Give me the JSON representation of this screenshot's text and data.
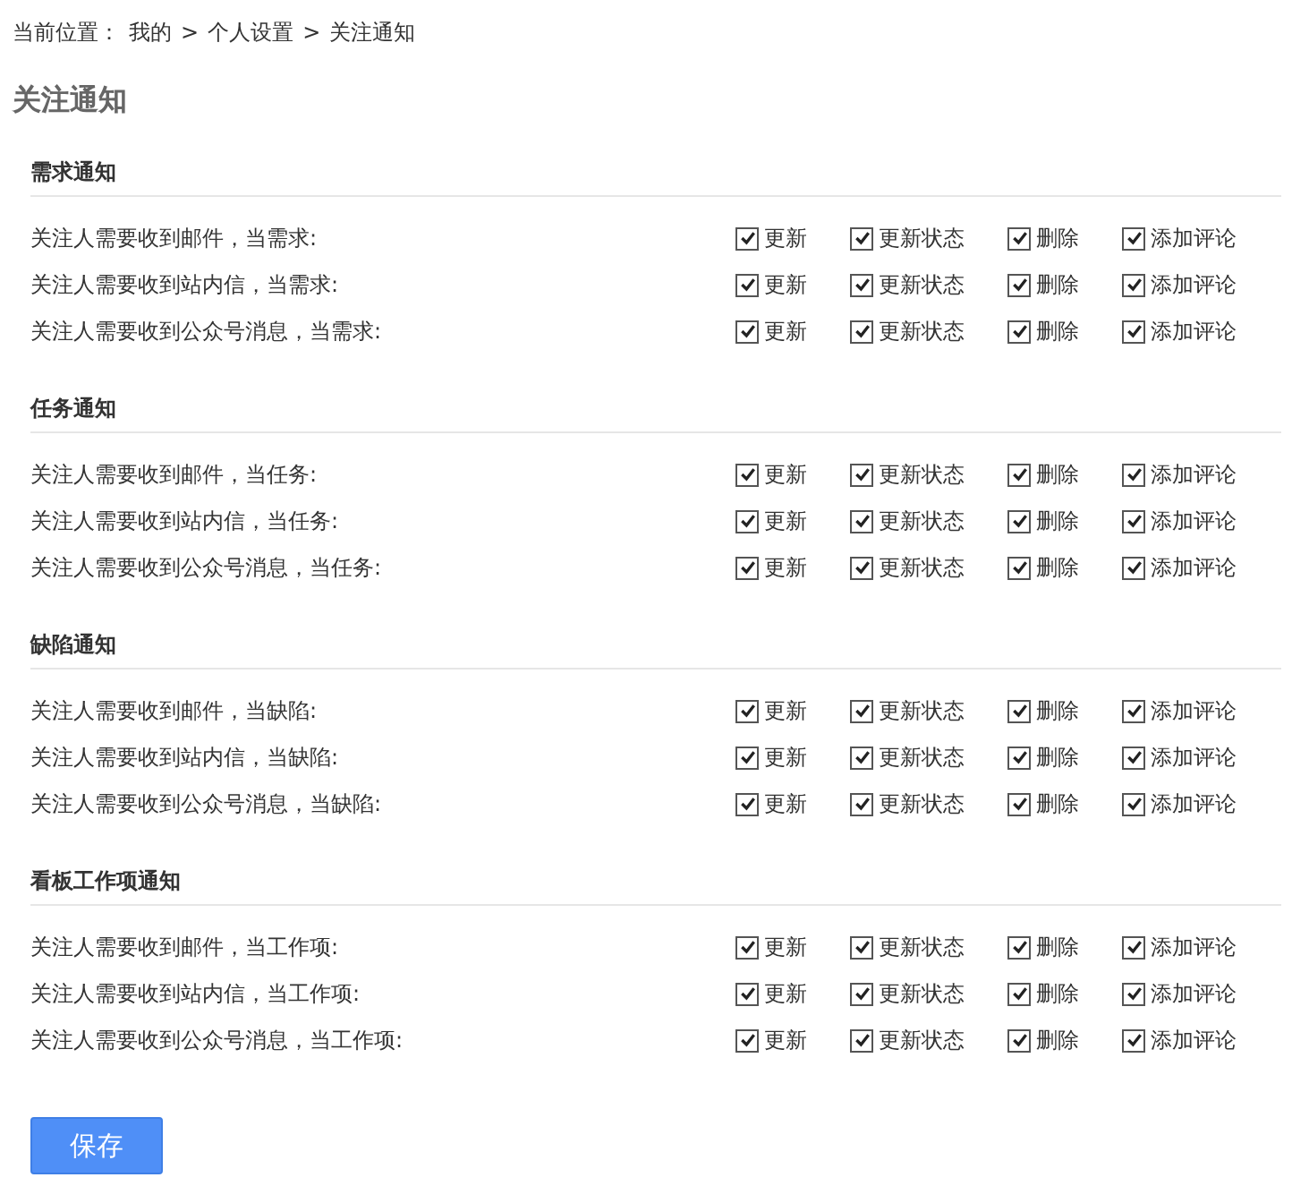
{
  "breadcrumb": {
    "label": "当前位置：",
    "separator": ">",
    "items": [
      "我的",
      "个人设置",
      "关注通知"
    ]
  },
  "title": "关注通知",
  "sections": [
    {
      "heading": "需求通知",
      "rows": [
        {
          "label": "关注人需要收到邮件，当需求:",
          "options": [
            {
              "label": "更新",
              "checked": true
            },
            {
              "label": "更新状态",
              "checked": true
            },
            {
              "label": "删除",
              "checked": true
            },
            {
              "label": "添加评论",
              "checked": true
            }
          ]
        },
        {
          "label": "关注人需要收到站内信，当需求:",
          "options": [
            {
              "label": "更新",
              "checked": true
            },
            {
              "label": "更新状态",
              "checked": true
            },
            {
              "label": "删除",
              "checked": true
            },
            {
              "label": "添加评论",
              "checked": true
            }
          ]
        },
        {
          "label": "关注人需要收到公众号消息，当需求:",
          "options": [
            {
              "label": "更新",
              "checked": true
            },
            {
              "label": "更新状态",
              "checked": true
            },
            {
              "label": "删除",
              "checked": true
            },
            {
              "label": "添加评论",
              "checked": true
            }
          ]
        }
      ]
    },
    {
      "heading": "任务通知",
      "rows": [
        {
          "label": "关注人需要收到邮件，当任务:",
          "options": [
            {
              "label": "更新",
              "checked": true
            },
            {
              "label": "更新状态",
              "checked": true
            },
            {
              "label": "删除",
              "checked": true
            },
            {
              "label": "添加评论",
              "checked": true
            }
          ]
        },
        {
          "label": "关注人需要收到站内信，当任务:",
          "options": [
            {
              "label": "更新",
              "checked": true
            },
            {
              "label": "更新状态",
              "checked": true
            },
            {
              "label": "删除",
              "checked": true
            },
            {
              "label": "添加评论",
              "checked": true
            }
          ]
        },
        {
          "label": "关注人需要收到公众号消息，当任务:",
          "options": [
            {
              "label": "更新",
              "checked": true
            },
            {
              "label": "更新状态",
              "checked": true
            },
            {
              "label": "删除",
              "checked": true
            },
            {
              "label": "添加评论",
              "checked": true
            }
          ]
        }
      ]
    },
    {
      "heading": "缺陷通知",
      "rows": [
        {
          "label": "关注人需要收到邮件，当缺陷:",
          "options": [
            {
              "label": "更新",
              "checked": true
            },
            {
              "label": "更新状态",
              "checked": true
            },
            {
              "label": "删除",
              "checked": true
            },
            {
              "label": "添加评论",
              "checked": true
            }
          ]
        },
        {
          "label": "关注人需要收到站内信，当缺陷:",
          "options": [
            {
              "label": "更新",
              "checked": true
            },
            {
              "label": "更新状态",
              "checked": true
            },
            {
              "label": "删除",
              "checked": true
            },
            {
              "label": "添加评论",
              "checked": true
            }
          ]
        },
        {
          "label": "关注人需要收到公众号消息，当缺陷:",
          "options": [
            {
              "label": "更新",
              "checked": true
            },
            {
              "label": "更新状态",
              "checked": true
            },
            {
              "label": "删除",
              "checked": true
            },
            {
              "label": "添加评论",
              "checked": true
            }
          ]
        }
      ]
    },
    {
      "heading": "看板工作项通知",
      "rows": [
        {
          "label": "关注人需要收到邮件，当工作项:",
          "options": [
            {
              "label": "更新",
              "checked": true
            },
            {
              "label": "更新状态",
              "checked": true
            },
            {
              "label": "删除",
              "checked": true
            },
            {
              "label": "添加评论",
              "checked": true
            }
          ]
        },
        {
          "label": "关注人需要收到站内信，当工作项:",
          "options": [
            {
              "label": "更新",
              "checked": true
            },
            {
              "label": "更新状态",
              "checked": true
            },
            {
              "label": "删除",
              "checked": true
            },
            {
              "label": "添加评论",
              "checked": true
            }
          ]
        },
        {
          "label": "关注人需要收到公众号消息，当工作项:",
          "options": [
            {
              "label": "更新",
              "checked": true
            },
            {
              "label": "更新状态",
              "checked": true
            },
            {
              "label": "删除",
              "checked": true
            },
            {
              "label": "添加评论",
              "checked": true
            }
          ]
        }
      ]
    }
  ],
  "save_button": "保存"
}
